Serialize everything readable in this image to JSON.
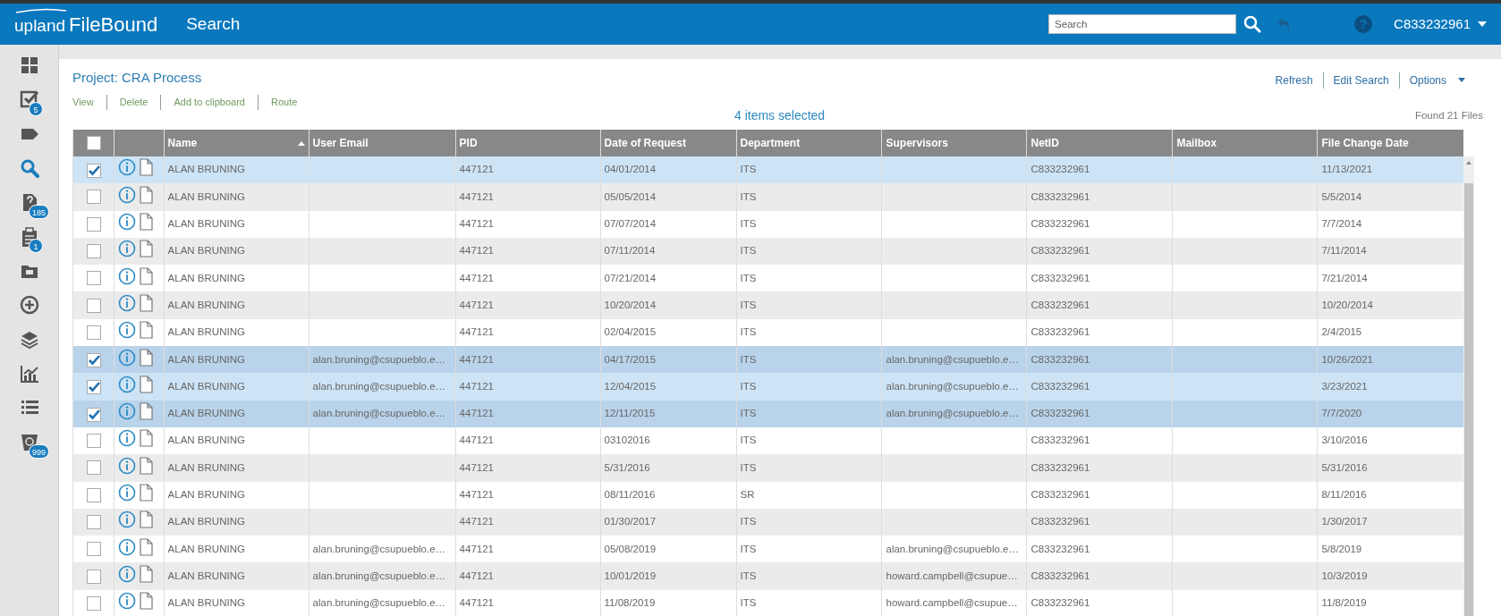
{
  "app": {
    "logo_prefix": "upland",
    "logo_name": "FileBound",
    "page_title": "Search"
  },
  "top_search": {
    "placeholder": "Search"
  },
  "help_glyph": "?",
  "user": "C833232961",
  "sidebar": [
    {
      "kind": "dashboard",
      "selected": false
    },
    {
      "kind": "tasks",
      "badge": "5",
      "selected": false
    },
    {
      "kind": "tag",
      "selected": false
    },
    {
      "kind": "search",
      "selected": true
    },
    {
      "kind": "question",
      "badge": "185",
      "selected": false
    },
    {
      "kind": "clipboard",
      "badge": "1",
      "selected": false
    },
    {
      "kind": "folder",
      "selected": false
    },
    {
      "kind": "add",
      "selected": false
    },
    {
      "kind": "layers",
      "selected": false
    },
    {
      "kind": "chart",
      "selected": false
    },
    {
      "kind": "list",
      "selected": false
    },
    {
      "kind": "recycle",
      "badge": "999",
      "selected": false
    }
  ],
  "project_title": "Project: CRA Process",
  "actions": [
    "View",
    "Delete",
    "Add to clipboard",
    "Route"
  ],
  "header_links": [
    "Refresh",
    "Edit Search",
    "Options"
  ],
  "selection_summary": "4 items selected",
  "found": "Found 21 Files",
  "table": {
    "select_all_checked": false,
    "columns": [
      {
        "label": "Name",
        "sorted": true
      },
      {
        "label": "User Email",
        "sorted": false
      },
      {
        "label": "PID",
        "sorted": false
      },
      {
        "label": "Date of Request",
        "sorted": false
      },
      {
        "label": "Department",
        "sorted": false
      },
      {
        "label": "Supervisors",
        "sorted": false
      },
      {
        "label": "NetID",
        "sorted": false
      },
      {
        "label": "Mailbox",
        "sorted": false
      },
      {
        "label": "File Change Date",
        "sorted": false
      }
    ],
    "rows": [
      {
        "checked": true,
        "cells": [
          "ALAN BRUNING",
          "",
          "447121",
          "04/01/2014",
          "ITS",
          "",
          "C833232961",
          "",
          "11/13/2021"
        ]
      },
      {
        "checked": false,
        "cells": [
          "ALAN BRUNING",
          "",
          "447121",
          "05/05/2014",
          "ITS",
          "",
          "C833232961",
          "",
          "5/5/2014"
        ]
      },
      {
        "checked": false,
        "cells": [
          "ALAN BRUNING",
          "",
          "447121",
          "07/07/2014",
          "ITS",
          "",
          "C833232961",
          "",
          "7/7/2014"
        ]
      },
      {
        "checked": false,
        "cells": [
          "ALAN BRUNING",
          "",
          "447121",
          "07/11/2014",
          "ITS",
          "",
          "C833232961",
          "",
          "7/11/2014"
        ]
      },
      {
        "checked": false,
        "cells": [
          "ALAN BRUNING",
          "",
          "447121",
          "07/21/2014",
          "ITS",
          "",
          "C833232961",
          "",
          "7/21/2014"
        ]
      },
      {
        "checked": false,
        "cells": [
          "ALAN BRUNING",
          "",
          "447121",
          "10/20/2014",
          "ITS",
          "",
          "C833232961",
          "",
          "10/20/2014"
        ]
      },
      {
        "checked": false,
        "cells": [
          "ALAN BRUNING",
          "",
          "447121",
          "02/04/2015",
          "ITS",
          "",
          "C833232961",
          "",
          "2/4/2015"
        ]
      },
      {
        "checked": true,
        "cells": [
          "ALAN BRUNING",
          "alan.bruning@csupueblo.e…",
          "447121",
          "04/17/2015",
          "ITS",
          "alan.bruning@csupueblo.e…",
          "C833232961",
          "",
          "10/26/2021"
        ]
      },
      {
        "checked": true,
        "cells": [
          "ALAN BRUNING",
          "alan.bruning@csupueblo.e…",
          "447121",
          "12/04/2015",
          "ITS",
          "alan.bruning@csupueblo.e…",
          "C833232961",
          "",
          "3/23/2021"
        ]
      },
      {
        "checked": true,
        "cells": [
          "ALAN BRUNING",
          "alan.bruning@csupueblo.e…",
          "447121",
          "12/11/2015",
          "ITS",
          "alan.bruning@csupueblo.e…",
          "C833232961",
          "",
          "7/7/2020"
        ]
      },
      {
        "checked": false,
        "cells": [
          "ALAN BRUNING",
          "",
          "447121",
          "03102016",
          "ITS",
          "",
          "C833232961",
          "",
          "3/10/2016"
        ]
      },
      {
        "checked": false,
        "cells": [
          "ALAN BRUNING",
          "",
          "447121",
          "5/31/2016",
          "ITS",
          "",
          "C833232961",
          "",
          "5/31/2016"
        ]
      },
      {
        "checked": false,
        "cells": [
          "ALAN BRUNING",
          "",
          "447121",
          "08/11/2016",
          "SR",
          "",
          "C833232961",
          "",
          "8/11/2016"
        ]
      },
      {
        "checked": false,
        "cells": [
          "ALAN BRUNING",
          "",
          "447121",
          "01/30/2017",
          "ITS",
          "",
          "C833232961",
          "",
          "1/30/2017"
        ]
      },
      {
        "checked": false,
        "cells": [
          "ALAN BRUNING",
          "alan.bruning@csupueblo.e…",
          "447121",
          "05/08/2019",
          "ITS",
          "alan.bruning@csupueblo.e…",
          "C833232961",
          "",
          "5/8/2019"
        ]
      },
      {
        "checked": false,
        "cells": [
          "ALAN BRUNING",
          "alan.bruning@csupueblo.e…",
          "447121",
          "10/01/2019",
          "ITS",
          "howard.campbell@csupue…",
          "C833232961",
          "",
          "10/3/2019"
        ]
      },
      {
        "checked": false,
        "cells": [
          "ALAN BRUNING",
          "alan.bruning@csupueblo.e…",
          "447121",
          "11/08/2019",
          "ITS",
          "howard.campbell@csupue…",
          "C833232961",
          "",
          "11/8/2019"
        ]
      }
    ]
  }
}
